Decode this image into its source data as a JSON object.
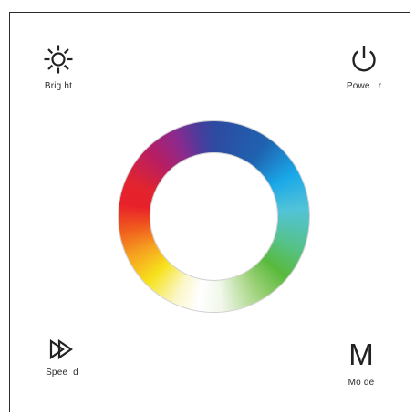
{
  "controls": {
    "bright": {
      "label": "Brig ht",
      "icon": "sun-icon"
    },
    "power": {
      "label": "Powe   r",
      "icon": "power-icon"
    },
    "speed": {
      "label": "Spee  d",
      "icon": "fast-forward-icon"
    },
    "mode": {
      "label": "Mo de",
      "glyph": "M",
      "icon": "mode-icon"
    }
  },
  "color_wheel": {
    "icon": "color-ring"
  },
  "colors": {
    "border": "#2a2a2a",
    "text": "#2b2b2b"
  }
}
